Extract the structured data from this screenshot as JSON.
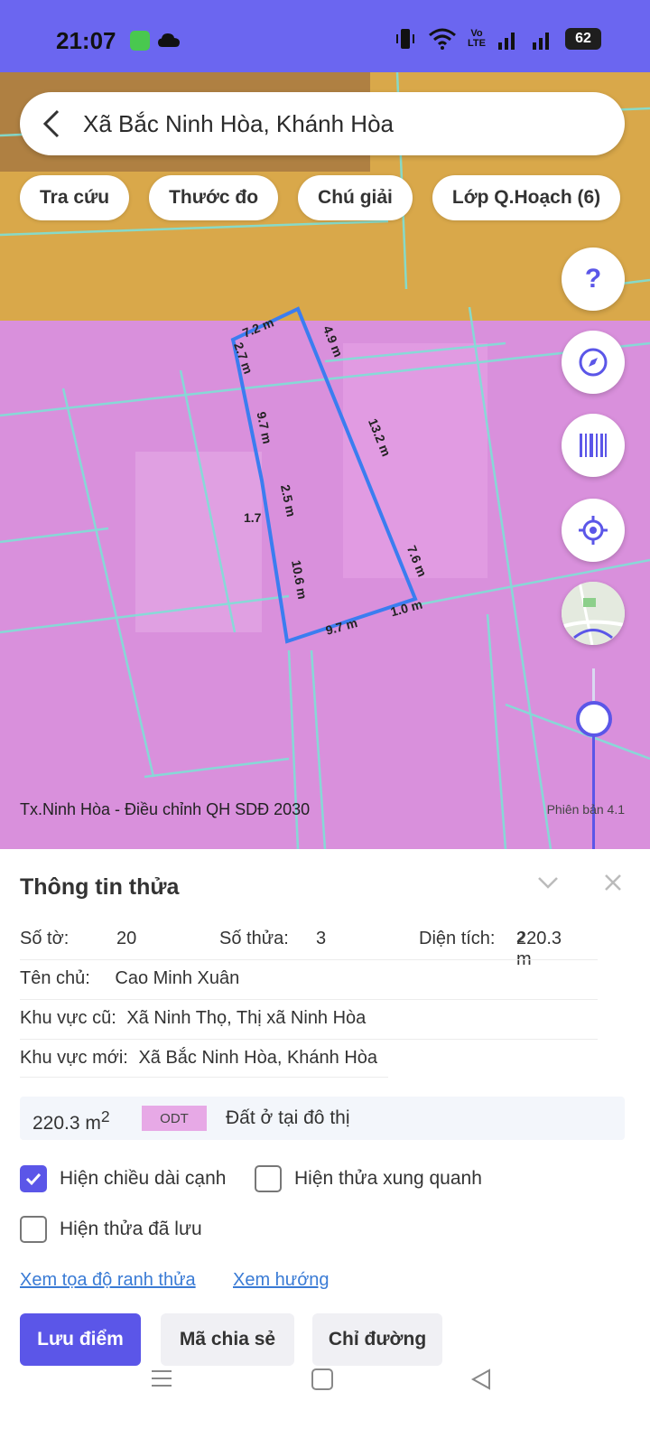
{
  "status_bar": {
    "time": "21:07",
    "volte_line1": "Vo",
    "volte_line2": "LTE",
    "battery": "62"
  },
  "search": {
    "text": "Xã Bắc Ninh Hòa, Khánh Hòa"
  },
  "chips": [
    "Tra cứu",
    "Thước đo",
    "Chú giải",
    "Lớp Q.Hoạch (6)"
  ],
  "map": {
    "help_label": "?",
    "caption": "Tx.Ninh Hòa - Điều chỉnh QH SDĐ 2030",
    "version": "Phiên bản 4.1",
    "edges": [
      "7.2 m",
      "4.9 m",
      "2.7 m",
      "9.7 m",
      "13.2 m",
      "2.5 m",
      "1.7",
      "10.6 m",
      "7.6 m",
      "9.7 m",
      "1.0 m"
    ],
    "zoom_level": 0.28
  },
  "panel": {
    "title": "Thông tin thửa",
    "so_to_label": "Số tờ:",
    "so_to_value": "20",
    "so_thua_label": "Số thửa:",
    "so_thua_value": "3",
    "dien_tich_label": "Diện tích:",
    "dien_tich_value": "220.3 m",
    "dien_tich_unit_sup": "2",
    "ten_chu_label": "Tên chủ:",
    "ten_chu_value": "Cao Minh Xuân",
    "khu_vuc_cu_label": "Khu vực cũ:",
    "khu_vuc_cu_value": "Xã Ninh Thọ, Thị xã Ninh Hòa",
    "khu_vuc_moi_label": "Khu vực mới:",
    "khu_vuc_moi_value": "Xã Bắc Ninh Hòa, Khánh Hòa",
    "area_value": "220.3 m",
    "area_sup": "2",
    "land_code": "ODT",
    "land_desc": "Đất ở tại đô thị",
    "checkboxes": {
      "show_edges": "Hiện chiều dài cạnh",
      "show_neighbors": "Hiện thửa xung quanh",
      "show_saved": "Hiện thửa đã lưu"
    },
    "links": {
      "coords": "Xem tọa độ ranh thửa",
      "direction": "Xem hướng"
    },
    "buttons": {
      "save": "Lưu điểm",
      "share": "Mã chia sẻ",
      "route": "Chỉ đường"
    }
  },
  "colors": {
    "accent": "#5b56e8",
    "zone_pink": "#d990dc",
    "zone_orange": "#d9a84a",
    "parcel_line": "#7fe0d6"
  }
}
